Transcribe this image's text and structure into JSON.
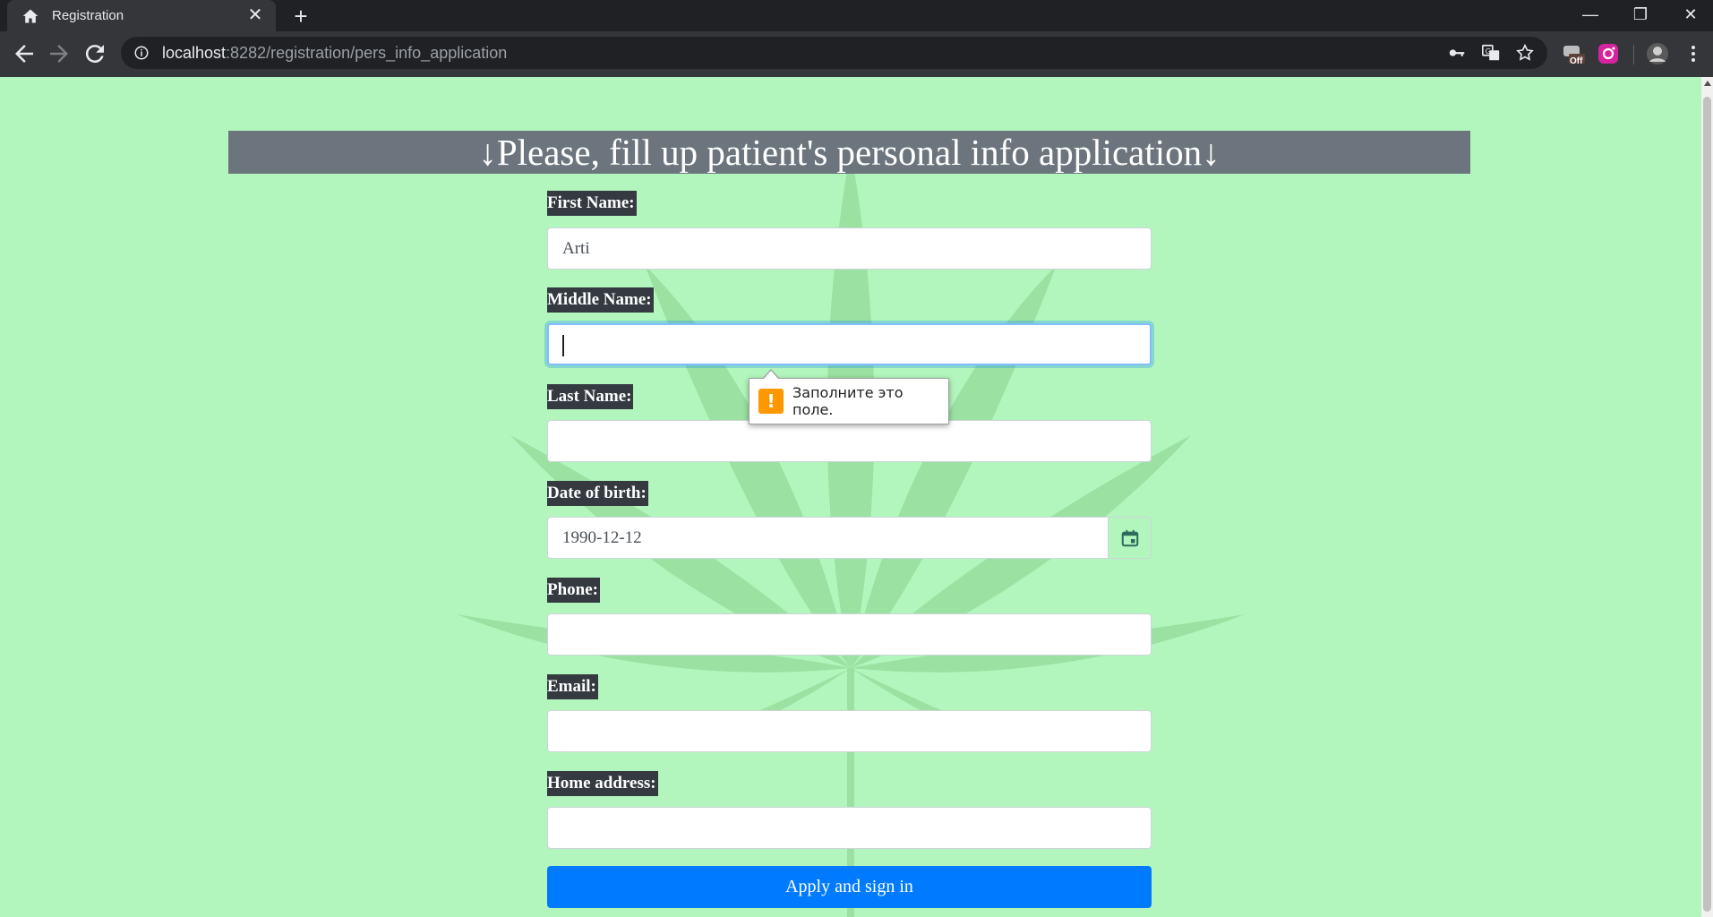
{
  "browser": {
    "tab_title": "Registration",
    "tab_close": "✕",
    "new_tab": "+",
    "url_host": "localhost",
    "url_rest": ":8282/registration/pers_info_application",
    "win_minimize": "—",
    "win_restore": "❐",
    "win_close": "✕",
    "ext_badge": "Off"
  },
  "page": {
    "heading": "↓Please, fill up patient's personal info application↓",
    "fields": {
      "first_name_label": "First Name:",
      "first_name_value": "Arti",
      "middle_name_label": "Middle Name:",
      "middle_name_value": "",
      "last_name_label": "Last Name:",
      "last_name_value": "",
      "dob_label": "Date of birth:",
      "dob_value": "1990-12-12",
      "phone_label": "Phone:",
      "phone_value": "",
      "email_label": "Email:",
      "email_value": "",
      "address_label": "Home address:",
      "address_value": ""
    },
    "submit_label": "Apply and sign in",
    "validation_tooltip": "Заполните это поле.",
    "validation_icon": "!"
  },
  "colors": {
    "page_bg": "#b2f6bd",
    "heading_bg": "#6c757d",
    "label_bg": "#343a40",
    "submit_bg": "#007bff",
    "warning": "#ff9800"
  }
}
